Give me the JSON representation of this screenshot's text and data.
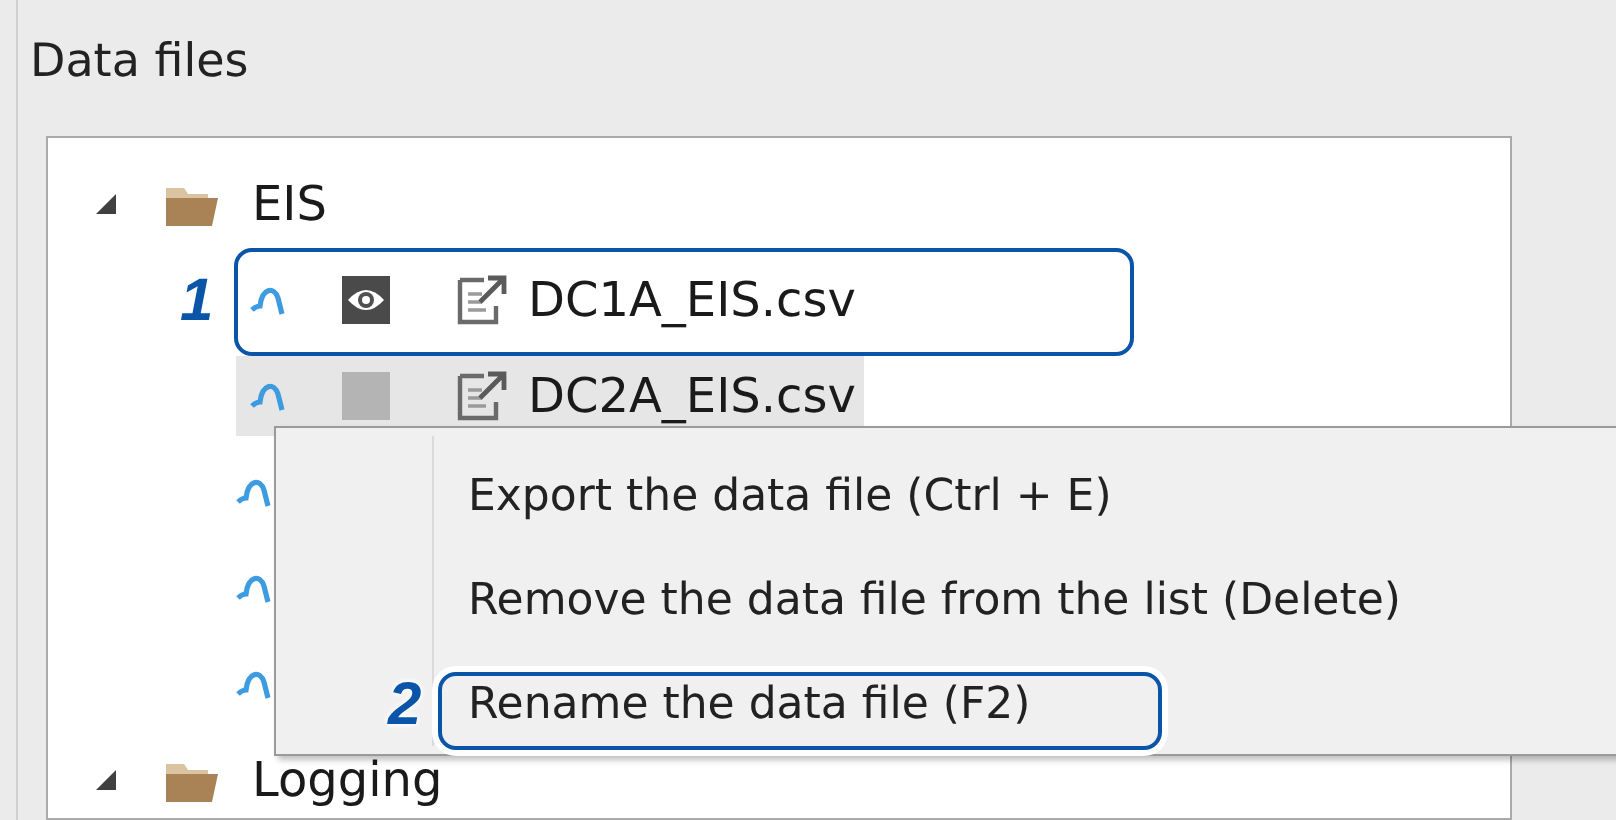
{
  "panel": {
    "title": "Data files"
  },
  "tree": [
    {
      "label": "EIS",
      "expanded": true,
      "children": [
        {
          "kind": "file",
          "label": "DC1A_EIS.csv",
          "visible": true,
          "selected": false,
          "callout": "1"
        },
        {
          "kind": "file",
          "label": "DC2A_EIS.csv",
          "visible": false,
          "selected": true
        },
        {
          "kind": "covered"
        },
        {
          "kind": "covered"
        },
        {
          "kind": "covered"
        }
      ]
    },
    {
      "label": "Logging",
      "expanded": true
    }
  ],
  "context_menu": [
    {
      "label": "Export the data file (Ctrl + E)"
    },
    {
      "label": "Remove the data file from the list (Delete)"
    },
    {
      "label": "Rename the data file (F2)",
      "callout": "2"
    }
  ]
}
